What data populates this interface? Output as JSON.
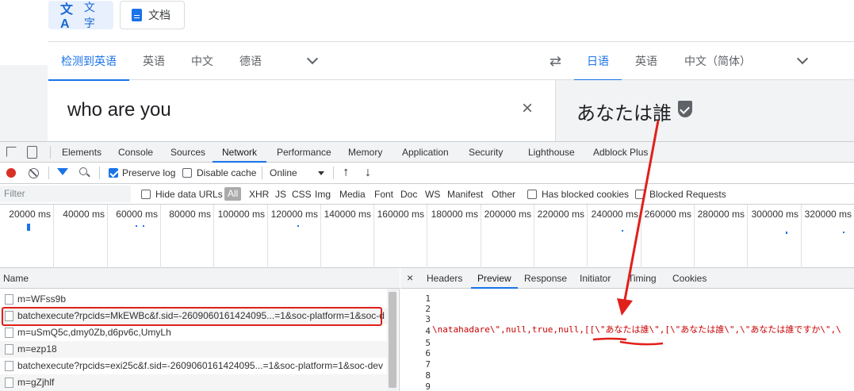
{
  "mode_buttons": {
    "text": "文字",
    "docs": "文档"
  },
  "source_langs": [
    "检测到英语",
    "英语",
    "中文",
    "德语"
  ],
  "target_langs": [
    "日语",
    "英语",
    "中文（简体）"
  ],
  "source_text": "who are you",
  "target_text": "あなたは誰",
  "devtools": {
    "tabs": [
      "Elements",
      "Console",
      "Sources",
      "Network",
      "Performance",
      "Memory",
      "Application",
      "Security",
      "Lighthouse",
      "Adblock Plus"
    ],
    "active_tab": "Network",
    "toolbar": {
      "preserve_log": "Preserve log",
      "disable_cache": "Disable cache",
      "throttle": "Online"
    },
    "filter": {
      "placeholder": "Filter",
      "hide_data_urls": "Hide data URLs",
      "all": "All",
      "types": [
        "XHR",
        "JS",
        "CSS",
        "Img",
        "Media",
        "Font",
        "Doc",
        "WS",
        "Manifest",
        "Other"
      ],
      "has_blocked_cookies": "Has blocked cookies",
      "blocked_requests": "Blocked Requests"
    },
    "timeline_ticks": [
      "20000 ms",
      "40000 ms",
      "60000 ms",
      "80000 ms",
      "100000 ms",
      "120000 ms",
      "140000 ms",
      "160000 ms",
      "180000 ms",
      "200000 ms",
      "220000 ms",
      "240000 ms",
      "260000 ms",
      "280000 ms",
      "300000 ms",
      "320000 ms"
    ],
    "name_header": "Name",
    "requests": [
      "m=WFss9b",
      "batchexecute?rpcids=MkEWBc&f.sid=-2609060161424095...=1&soc-platform=1&soc-d",
      "m=uSmQ5c,dmy0Zb,d6pv6c,UmyLh",
      "m=ezp18",
      "batchexecute?rpcids=exi25c&f.sid=-2609060161424095...=1&soc-platform=1&soc-dev",
      "m=gZjhlf"
    ],
    "detail_close": "×",
    "detail_tabs": [
      "Headers",
      "Preview",
      "Response",
      "Initiator",
      "Timing",
      "Cookies"
    ],
    "active_detail_tab": "Preview",
    "line_numbers": [
      "1",
      "2",
      "3",
      "4",
      "5",
      "6",
      "7",
      "8",
      "9"
    ],
    "code_line_4": "\\natahadare\\\",null,true,null,[[\\\"あなたは誰\\\",[\\\"あなたは誰\\\",\\\"あなたは誰ですか\\\",\\"
  }
}
